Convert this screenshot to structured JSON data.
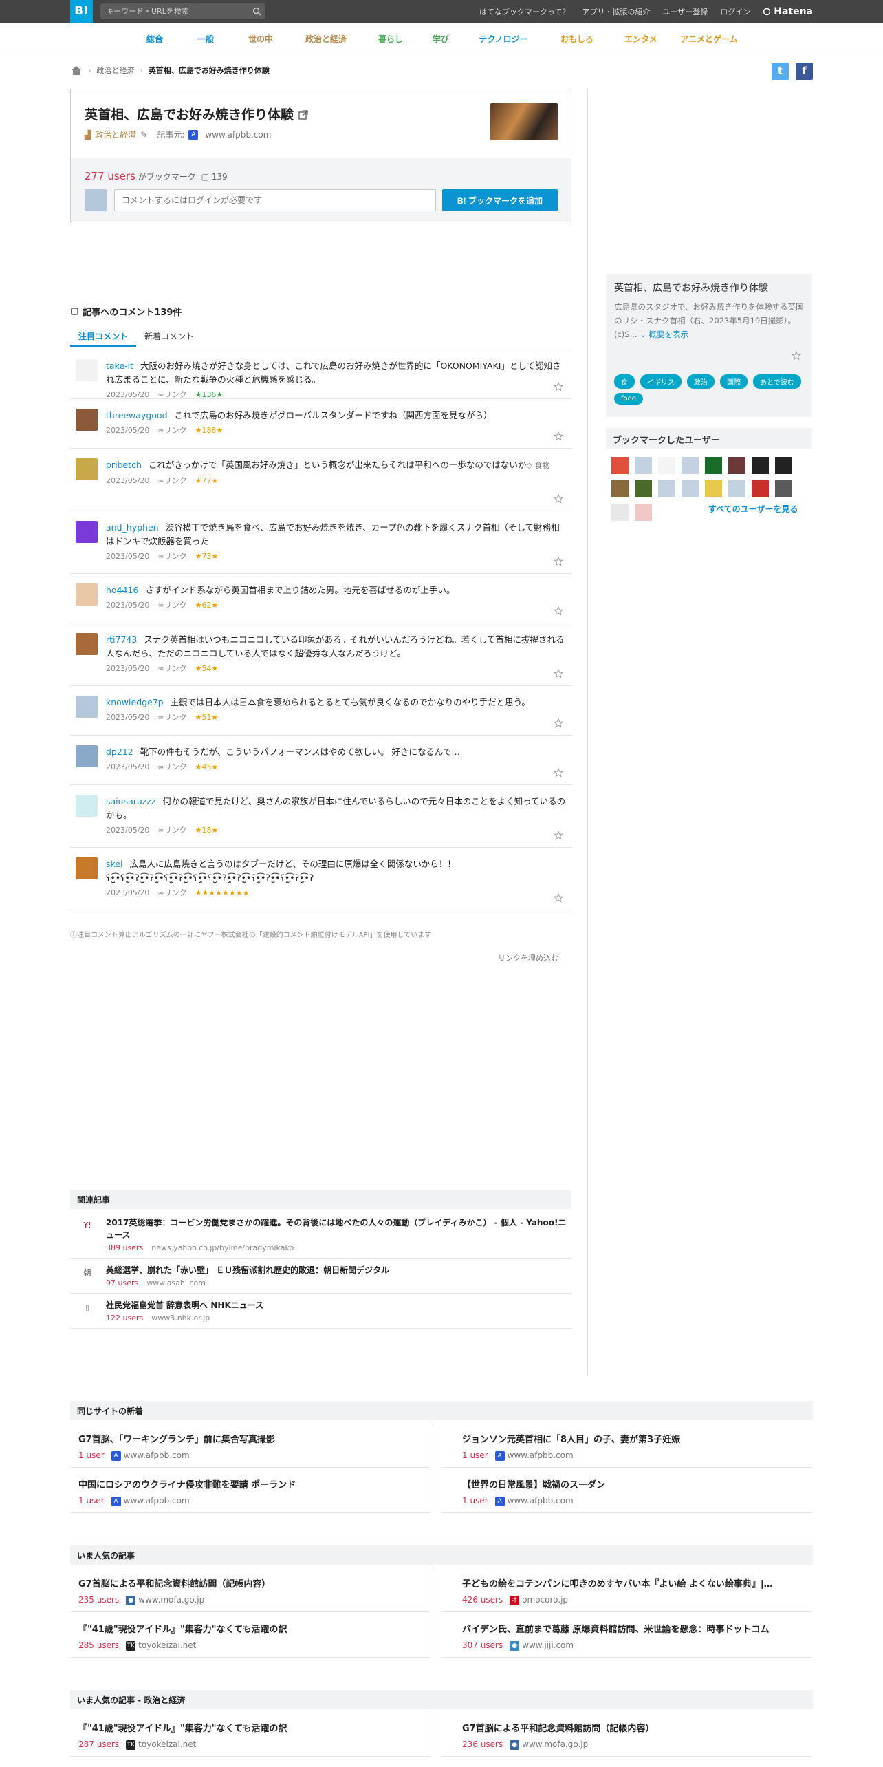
{
  "topbar": {
    "logo": "B!",
    "search_placeholder": "キーワード・URLを検索",
    "nav": [
      "はてなブックマークって？",
      "アプリ・拡張の紹介",
      "ユーザー登録",
      "ログイン"
    ],
    "brand": "Hatena"
  },
  "categories": [
    {
      "label": "総合",
      "color": "#0a8fd8"
    },
    {
      "label": "一般",
      "color": "#0a8fd8"
    },
    {
      "label": "世の中",
      "color": "#b98a4a"
    },
    {
      "label": "政治と経済",
      "color": "#b98a4a"
    },
    {
      "label": "暮らし",
      "color": "#4aa85a"
    },
    {
      "label": "学び",
      "color": "#4aa85a"
    },
    {
      "label": "テクノロジー",
      "color": "#0a8fd8"
    },
    {
      "label": "おもしろ",
      "color": "#e69a1a"
    },
    {
      "label": "エンタメ",
      "color": "#e69a1a"
    },
    {
      "label": "アニメとゲーム",
      "color": "#e69a1a"
    }
  ],
  "breadcrumb": {
    "category": "政治と経済",
    "current": "英首相、広島でお好み焼き作り体験"
  },
  "entry": {
    "title": "英首相、広島でお好み焼き作り体験",
    "category": "政治と経済",
    "source_label": "記事元:",
    "source": "www.afpbb.com",
    "users": "277 users",
    "users_suffix": "がブックマーク",
    "comment_count": "139",
    "comment_placeholder": "コメントするにはログインが必要です",
    "add_button": "B! ブックマークを追加"
  },
  "side": {
    "title": "英首相、広島でお好み焼き作り体験",
    "desc": "広島県のスタジオで、お好み焼き作りを体験する英国のリシ・スナク首相（右、2023年5月19日撮影）。(c)S...",
    "more": "概要を表示",
    "tags": [
      "食",
      "イギリス",
      "政治",
      "国際",
      "あとで読む",
      "food"
    ],
    "users_head": "ブックマークしたユーザー",
    "all_users": "すべてのユーザーを見る"
  },
  "comments_head": "記事へのコメント139件",
  "tabs": [
    "注目コメント",
    "新着コメント"
  ],
  "comments": [
    {
      "user": "take-it",
      "text": "大阪のお好み焼きが好きな身としては、これで広島のお好み焼きが世界的に「OKONOMIYAKI」として認知され広まることに、新たな戦争の火種と危機感を感じる。",
      "date": "2023/05/20",
      "link": "リンク",
      "stars": "★136★",
      "tag": "",
      "h": 72,
      "av": "#f2f2f2"
    },
    {
      "user": "threewaygood",
      "text": "これで広島のお好み焼きがグローバルスタンダードですね（関西方面を見ながら）",
      "date": "2023/05/20",
      "link": "リンク",
      "stars": "★188★",
      "tag": "",
      "h": 72,
      "av": "#8a5a3a"
    },
    {
      "user": "pribetch",
      "text": "これがきっかけで「英国風お好み焼き」という概念が出来たらそれは平和への一歩なのではないか",
      "date": "2023/05/20",
      "link": "リンク",
      "stars": "★77★",
      "tag": "食物",
      "h": 91,
      "av": "#c9a84a"
    },
    {
      "user": "and_hyphen",
      "text": "渋谷横丁で焼き鳥を食べ、広島でお好み焼きを焼き、カープ色の靴下を履くスナク首相（そして財務相はドンキで炊飯器を買った",
      "date": "2023/05/20",
      "link": "リンク",
      "stars": "★73★",
      "tag": "",
      "h": 91,
      "av": "#7a3ad8"
    },
    {
      "user": "ho4416",
      "text": "さすがインド系ながら英国首相まで上り詰めた男。地元を喜ばせるのが上手い。",
      "date": "2023/05/20",
      "link": "リンク",
      "stars": "★62★",
      "tag": "",
      "h": 72,
      "av": "#e8c8a8"
    },
    {
      "user": "rti7743",
      "text": "スナク英首相はいつもニコニコしている印象がある。それがいいんだろうけどね。若くして首相に抜擢される人なんだら、ただのニコニコしている人ではなく超優秀な人なんだろうけど。",
      "date": "2023/05/20",
      "link": "リンク",
      "stars": "★54★",
      "tag": "",
      "h": 91,
      "av": "#a86a3a"
    },
    {
      "user": "knowledge7p",
      "text": "主観では日本人は日本食を褒められるとるとても気が良くなるのでかなりのやり手だと思う。",
      "date": "2023/05/20",
      "link": "リンク",
      "stars": "★51★",
      "tag": "",
      "h": 72,
      "av": "#b5c7da"
    },
    {
      "user": "dp212",
      "text": "靴下の件もそうだが、こういうパフォーマンスはやめて欲しい。 好きになるんで…",
      "date": "2023/05/20",
      "link": "リンク",
      "stars": "★45★",
      "tag": "",
      "h": 72,
      "av": "#8aa8c8"
    },
    {
      "user": "saiusaruzzz",
      "text": "何かの報道で見たけど、奥さんの家族が日本に住んでいるらしいので元々日本のことをよく知っているのかも。",
      "date": "2023/05/20",
      "link": "リンク",
      "stars": "★18★",
      "tag": "",
      "h": 91,
      "av": "#d0eef2"
    },
    {
      "user": "skel",
      "text": "広島人に広島焼きと言うのはタブーだけど、その理由に原爆は全く関係ないから！！ ʕ•̫͡•ʕ•̫͡•ʔ•̫͡•ʔ•̫͡•ʕ•̫͡•ʔ•̫͡•ʕ•̫͡•ʕ•̫͡•ʔ•̫͡•ʔ•̫͡•ʕ•̫͡•ʔ•̫͡•ʕ•̫͡•ʔ•̫͡•ʔ",
      "date": "2023/05/20",
      "link": "リンク",
      "stars": "★★★★★★★★",
      "tag": "",
      "h": 91,
      "av": "#c87a2a"
    }
  ],
  "ai_note": "ⓘ注目コメント算出アルゴリズムの一部にヤフー株式会社の「建設的コメント順位付けモデルAPI」を使用しています",
  "embed": "リンクを埋め込む",
  "related": {
    "head": "関連記事",
    "items": [
      {
        "title": "2017英総選挙：コービン労働党まさかの躍進。その背後には地べたの人々の運動（ブレイディみかこ） - 個人 - Yahoo!ニュース",
        "users": "389 users",
        "src": "news.yahoo.co.jp/byline/bradymikako",
        "icon": "Y!",
        "icolor": "#d0021b"
      },
      {
        "title": "英総選挙、崩れた「赤い壁」 ＥＵ残留派割れ歴史的敗退：朝日新聞デジタル",
        "users": "97 users",
        "src": "www.asahi.com",
        "icon": "朝",
        "icolor": "#555"
      },
      {
        "title": "社民党福島党首 辞意表明へ NHKニュース",
        "users": "122 users",
        "src": "www3.nhk.or.jp",
        "icon": "▯",
        "icolor": "#888"
      }
    ]
  },
  "same_site": {
    "head": "同じサイトの新着",
    "items": [
      {
        "title": "G7首脳、「ワーキングランチ」前に集合写真撮影",
        "users": "1 user",
        "src": "www.afpbb.com",
        "fav": "A",
        "fcolor": "#2a5ad8"
      },
      {
        "title": "ジョンソン元英首相に「8人目」の子、妻が第3子妊娠",
        "users": "1 user",
        "src": "www.afpbb.com",
        "fav": "A",
        "fcolor": "#2a5ad8"
      },
      {
        "title": "中国にロシアのウクライナ侵攻非難を要請 ポーランド",
        "users": "1 user",
        "src": "www.afpbb.com",
        "fav": "A",
        "fcolor": "#2a5ad8"
      },
      {
        "title": "【世界の日常風景】戦禍のスーダン",
        "users": "1 user",
        "src": "www.afpbb.com",
        "fav": "A",
        "fcolor": "#2a5ad8"
      }
    ]
  },
  "popular": {
    "head": "いま人気の記事",
    "items": [
      {
        "title": "G7首脳による平和記念資料館訪問（記帳内容）",
        "users": "235 users",
        "src": "www.mofa.go.jp",
        "fav": "●",
        "fcolor": "#3a6aa8"
      },
      {
        "title": "子どもの絵をコテンパンに叩きのめすヤバい本『よい絵 よくない絵事典』|…",
        "users": "426 users",
        "src": "omocoro.jp",
        "fav": "オ",
        "fcolor": "#d0021b"
      },
      {
        "title": "『\"41歳\"現役アイドル』\"集客力\"なくても活躍の訳",
        "users": "285 users",
        "src": "toyokeizai.net",
        "fav": "TK",
        "fcolor": "#222"
      },
      {
        "title": "バイデン氏、直前まで葛藤 原爆資料館訪問、米世論を懸念：時事ドットコム",
        "users": "307 users",
        "src": "www.jiji.com",
        "fav": "●",
        "fcolor": "#3a8ac8"
      }
    ]
  },
  "popular_pol": {
    "head": "いま人気の記事 - 政治と経済",
    "items": [
      {
        "title": "『\"41歳\"現役アイドル』\"集客力\"なくても活躍の訳",
        "users": "287 users",
        "src": "toyokeizai.net",
        "fav": "TK",
        "fcolor": "#222"
      },
      {
        "title": "G7首脳による平和記念資料館訪問（記帳内容）",
        "users": "236 users",
        "src": "www.mofa.go.jp",
        "fav": "●",
        "fcolor": "#3a6aa8"
      }
    ]
  }
}
